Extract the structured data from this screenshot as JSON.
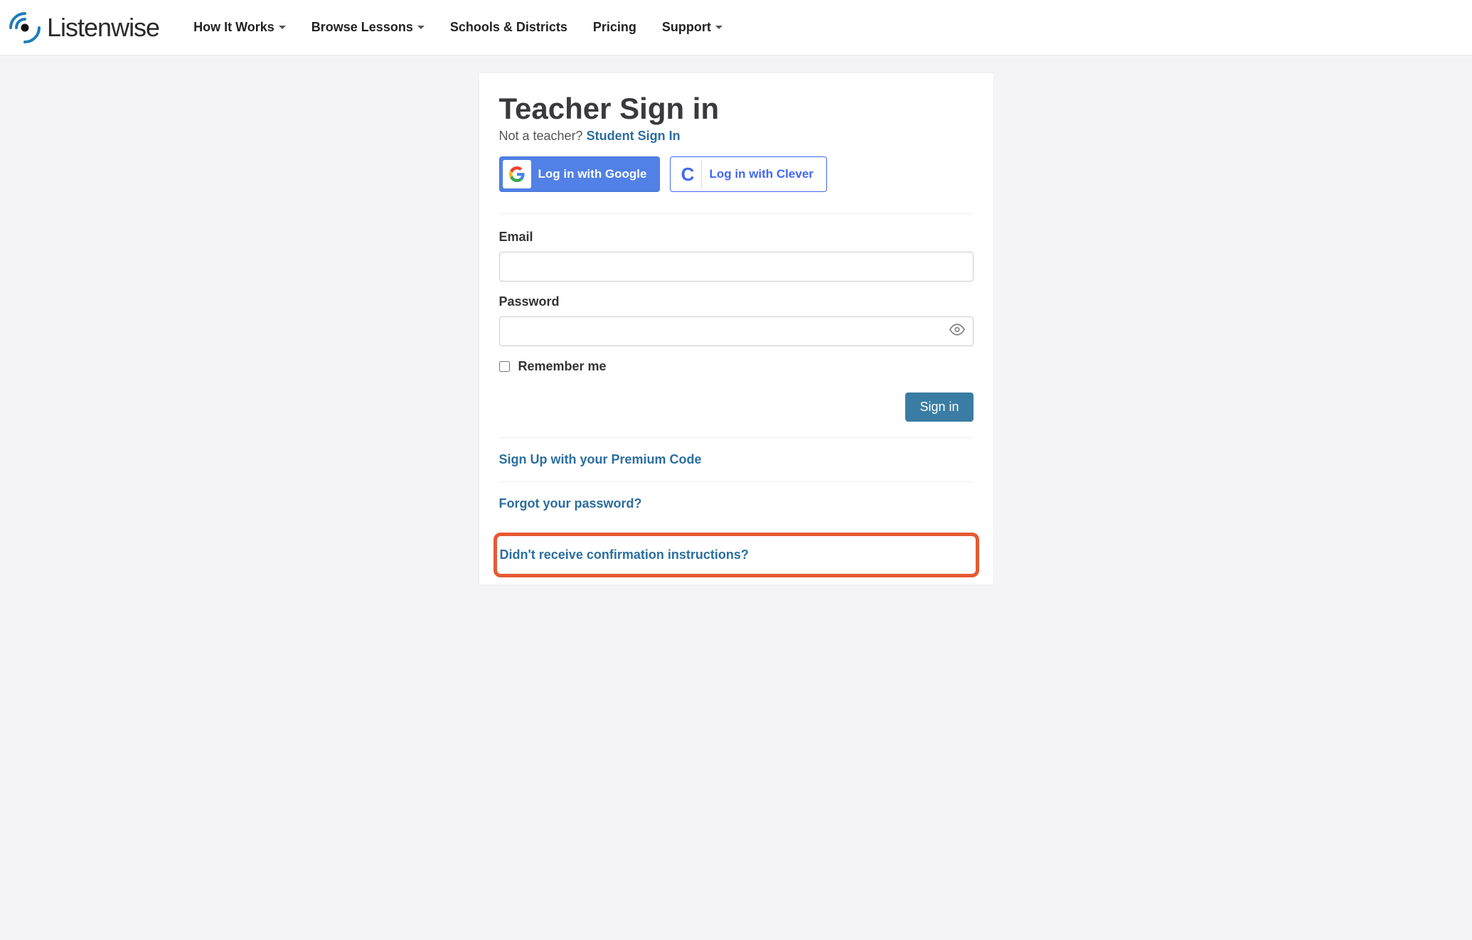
{
  "brand": "Listenwise",
  "nav": {
    "how_it_works": "How It Works",
    "browse_lessons": "Browse Lessons",
    "schools_districts": "Schools & Districts",
    "pricing": "Pricing",
    "support": "Support"
  },
  "signin": {
    "title": "Teacher Sign in",
    "not_teacher": "Not a teacher? ",
    "student_link": "Student Sign In",
    "google_label": "Log in with Google",
    "clever_label": "Log in with Clever",
    "email_label": "Email",
    "password_label": "Password",
    "remember_label": "Remember me",
    "submit_label": "Sign in"
  },
  "links": {
    "premium": "Sign Up with your Premium Code",
    "forgot": "Forgot your password?",
    "confirmation": "Didn't receive confirmation instructions?"
  },
  "icons": {
    "google": "google-logo-icon",
    "clever": "clever-logo-icon",
    "eye": "eye-icon",
    "caret": "caret-down-icon"
  }
}
